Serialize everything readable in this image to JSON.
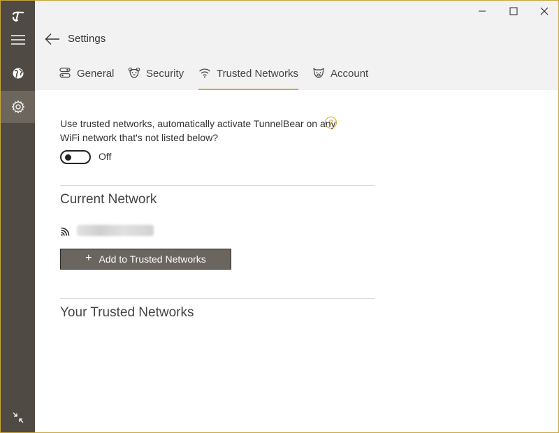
{
  "header": {
    "title": "Settings"
  },
  "tabs": [
    {
      "label": "General",
      "icon": "toggles-icon",
      "active": false
    },
    {
      "label": "Security",
      "icon": "bear-shield-icon",
      "active": false
    },
    {
      "label": "Trusted Networks",
      "icon": "wifi-icon",
      "active": true
    },
    {
      "label": "Account",
      "icon": "bear-face-icon",
      "active": false
    }
  ],
  "trusted": {
    "description": "Use trusted networks, automatically activate TunnelBear on any WiFi network that's not listed below?",
    "help_glyph": "?",
    "toggle_state": "Off",
    "toggle_on": false,
    "current_network_heading": "Current Network",
    "current_network_name": "",
    "add_button_label": "Add to Trusted Networks",
    "add_button_glyph": "+",
    "your_networks_heading": "Your Trusted Networks"
  },
  "colors": {
    "accent": "#d9a531",
    "rail": "#4f4a43",
    "rail_active": "#6c665d",
    "header_bg": "#f2f2f2",
    "button_bg": "#6a655e"
  }
}
